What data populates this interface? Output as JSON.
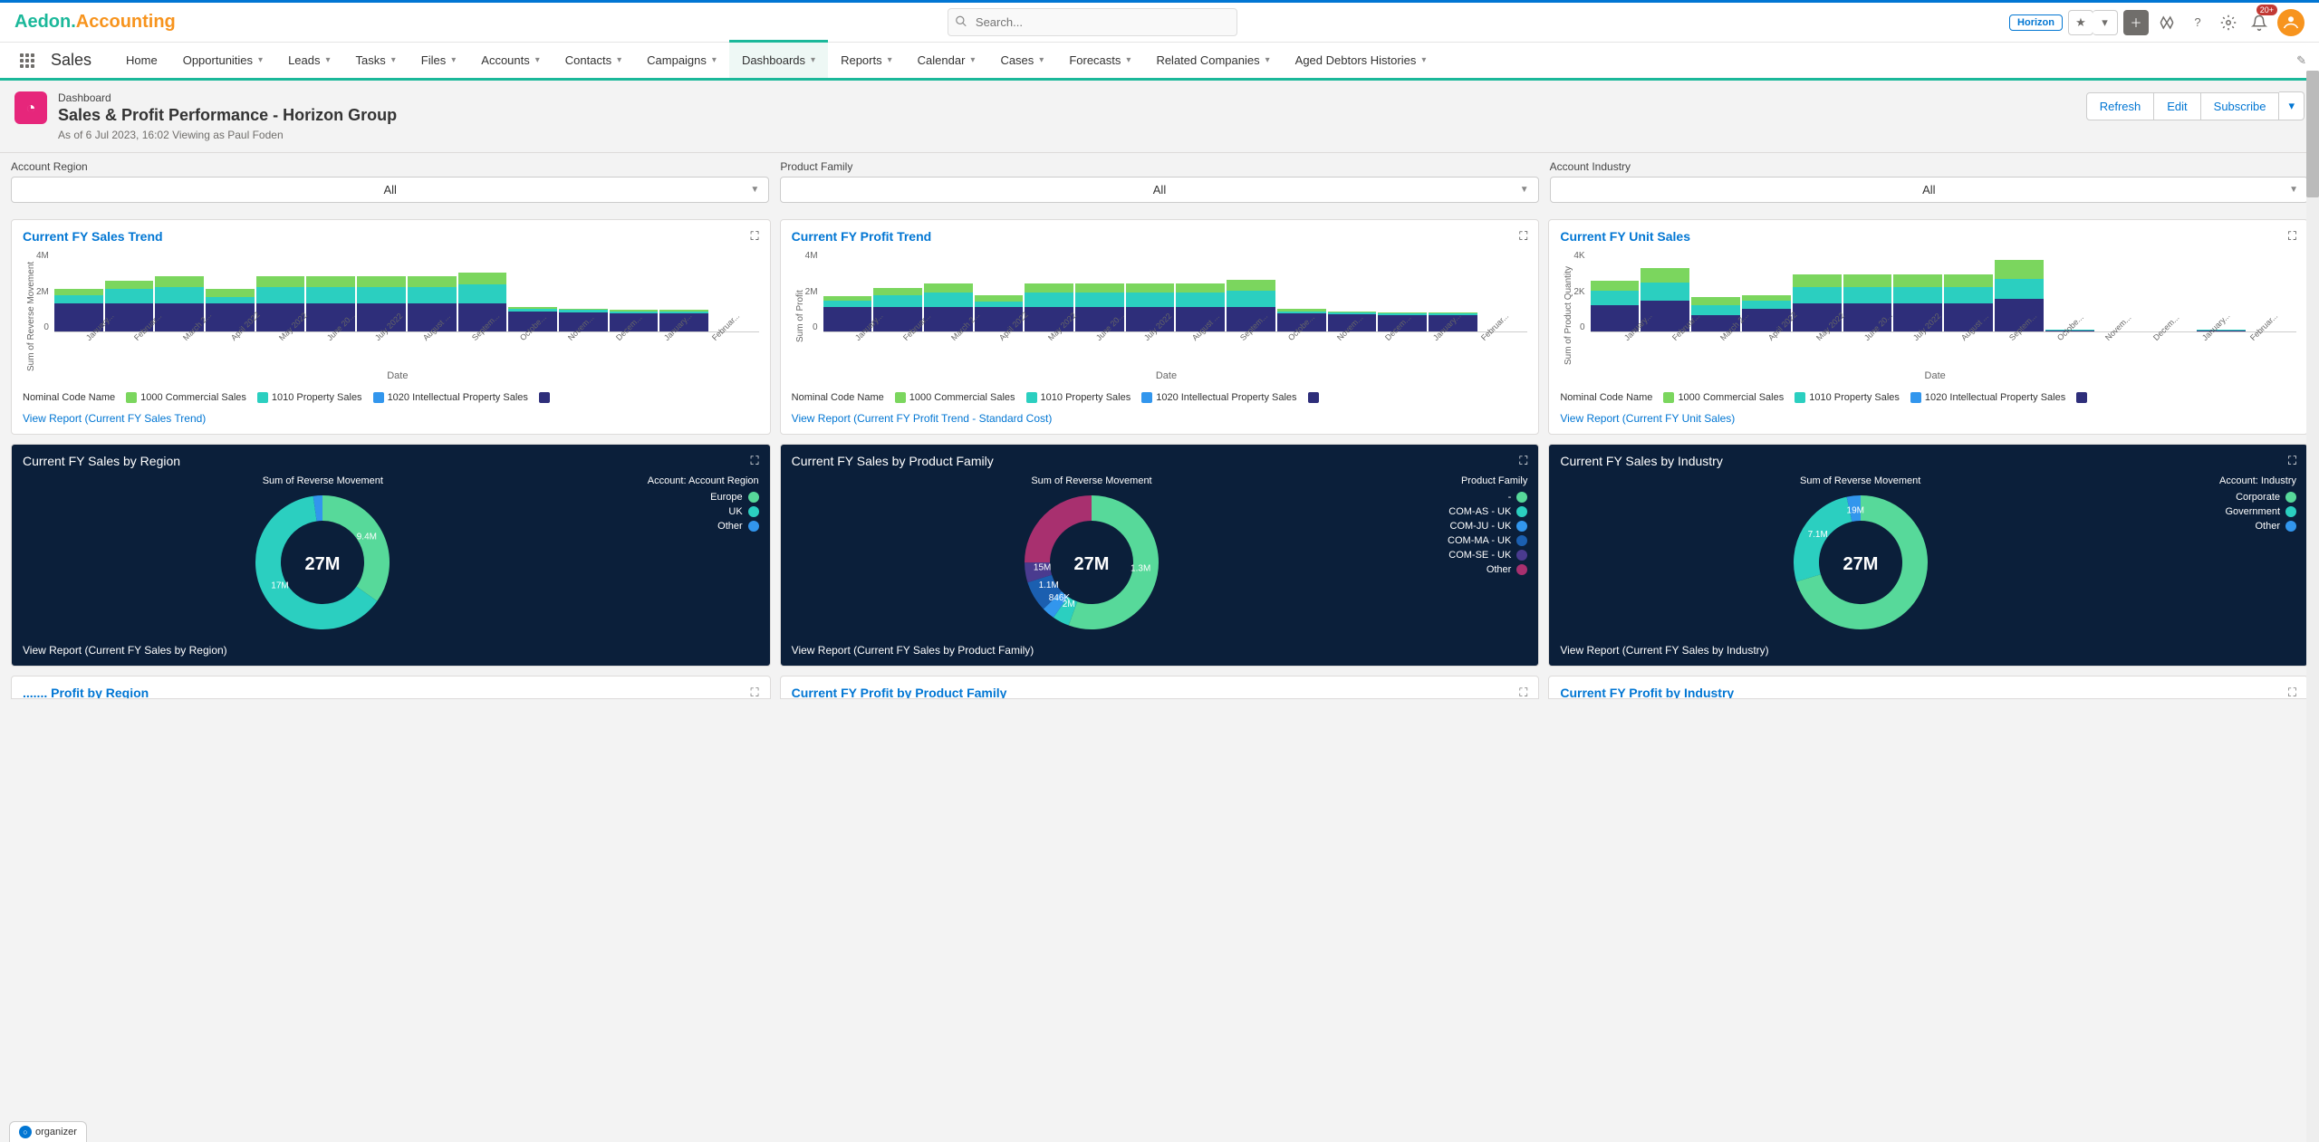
{
  "brand": {
    "a": "Aedon.",
    "b": "Accounting"
  },
  "search": {
    "placeholder": "Search..."
  },
  "header": {
    "horizon": "Horizon",
    "notif": "20+"
  },
  "nav": {
    "title": "Sales",
    "items": [
      "Home",
      "Opportunities",
      "Leads",
      "Tasks",
      "Files",
      "Accounts",
      "Contacts",
      "Campaigns",
      "Dashboards",
      "Reports",
      "Calendar",
      "Cases",
      "Forecasts",
      "Related Companies",
      "Aged Debtors Histories"
    ],
    "activeIndex": 8
  },
  "page": {
    "type": "Dashboard",
    "title": "Sales & Profit Performance - Horizon Group",
    "meta": "As of 6 Jul 2023, 16:02 Viewing as Paul Foden",
    "actions": {
      "refresh": "Refresh",
      "edit": "Edit",
      "subscribe": "Subscribe"
    }
  },
  "filters": [
    {
      "label": "Account Region",
      "value": "All"
    },
    {
      "label": "Product Family",
      "value": "All"
    },
    {
      "label": "Account Industry",
      "value": "All"
    }
  ],
  "legendLabel": "Nominal Code Name",
  "legendItems": [
    "1000 Commercial Sales",
    "1010 Property Sales",
    "1020 Intellectual Property Sales"
  ],
  "months": [
    "January...",
    "Februar...",
    "March 2...",
    "April 2022",
    "May 2022",
    "June 20...",
    "July 2022",
    "August ...",
    "Septem...",
    "Octobe...",
    "Novem...",
    "Decem...",
    "January...",
    "Februar..."
  ],
  "axisDate": "Date",
  "cards": {
    "sales": {
      "title": "Current FY Sales Trend",
      "ylabel": "Sum of Reverse Movement",
      "link": "View Report (Current FY Sales Trend)"
    },
    "profit": {
      "title": "Current FY Profit Trend",
      "ylabel": "Sum of Profit",
      "link": "View Report (Current FY Profit Trend - Standard Cost)"
    },
    "units": {
      "title": "Current FY Unit Sales",
      "ylabel": "Sum of Product Quantity",
      "link": "View Report (Current FY Unit Sales)"
    },
    "region": {
      "title": "Current FY Sales by Region",
      "link": "View Report (Current FY Sales by Region)",
      "legendTitle": "Account: Account Region",
      "center": "27M",
      "subtitle": "Sum of Reverse Movement"
    },
    "family": {
      "title": "Current FY Sales by Product Family",
      "link": "View Report (Current FY Sales by Product Family)",
      "legendTitle": "Product Family",
      "center": "27M",
      "subtitle": "Sum of Reverse Movement"
    },
    "industry": {
      "title": "Current FY Sales by Industry",
      "link": "View Report (Current FY Sales by Industry)",
      "legendTitle": "Account: Industry",
      "center": "27M",
      "subtitle": "Sum of Reverse Movement"
    }
  },
  "peek": {
    "region": "....... Profit by Region",
    "family": "Current FY Profit by Product Family",
    "industry": "Current FY Profit by Industry"
  },
  "donutLegends": {
    "region": [
      "Europe",
      "UK",
      "Other"
    ],
    "family": [
      "-",
      "COM-AS - UK",
      "COM-JU - UK",
      "COM-MA - UK",
      "COM-SE - UK",
      "Other"
    ],
    "industry": [
      "Corporate",
      "Government",
      "Other"
    ]
  },
  "donutLabels": {
    "region": [
      "9.4M",
      "17M"
    ],
    "family": [
      "1.3M",
      "2M",
      "846K",
      "1.1M",
      "15M"
    ],
    "industry": [
      "7.1M",
      "19M"
    ]
  },
  "organizer": "organizer",
  "chart_data": [
    {
      "id": "sales_trend",
      "type": "bar",
      "title": "Current FY Sales Trend",
      "xlabel": "Date",
      "ylabel": "Sum of Reverse Movement",
      "ylim": [
        0,
        4000000
      ],
      "yticks": [
        "4M",
        "2M",
        "0"
      ],
      "categories": [
        "Jan 2022",
        "Feb 2022",
        "Mar 2022",
        "Apr 2022",
        "May 2022",
        "Jun 2022",
        "Jul 2022",
        "Aug 2022",
        "Sep 2022",
        "Oct 2022",
        "Nov 2022",
        "Dec 2022",
        "Jan 2023",
        "Feb 2023"
      ],
      "series": [
        {
          "name": "1000 Commercial Sales",
          "values": [
            1400000,
            1400000,
            1400000,
            1400000,
            1400000,
            1400000,
            1400000,
            1400000,
            1400000,
            1000000,
            950000,
            900000,
            900000,
            0
          ]
        },
        {
          "name": "1010 Property Sales",
          "values": [
            400000,
            700000,
            800000,
            300000,
            800000,
            800000,
            800000,
            800000,
            900000,
            100000,
            100000,
            100000,
            100000,
            0
          ]
        },
        {
          "name": "1020 Intellectual Property Sales",
          "values": [
            300000,
            400000,
            500000,
            400000,
            500000,
            500000,
            500000,
            500000,
            600000,
            100000,
            50000,
            50000,
            50000,
            0
          ]
        }
      ]
    },
    {
      "id": "profit_trend",
      "type": "bar",
      "title": "Current FY Profit Trend",
      "xlabel": "Date",
      "ylabel": "Sum of Profit",
      "ylim": [
        0,
        4000000
      ],
      "yticks": [
        "4M",
        "2M",
        "0"
      ],
      "categories": [
        "Jan 2022",
        "Feb 2022",
        "Mar 2022",
        "Apr 2022",
        "May 2022",
        "Jun 2022",
        "Jul 2022",
        "Aug 2022",
        "Sep 2022",
        "Oct 2022",
        "Nov 2022",
        "Dec 2022",
        "Jan 2023",
        "Feb 2023"
      ],
      "series": [
        {
          "name": "1000 Commercial Sales",
          "values": [
            1200000,
            1200000,
            1200000,
            1200000,
            1200000,
            1200000,
            1200000,
            1200000,
            1200000,
            900000,
            850000,
            800000,
            800000,
            0
          ]
        },
        {
          "name": "1010 Property Sales",
          "values": [
            300000,
            600000,
            700000,
            250000,
            700000,
            700000,
            700000,
            700000,
            800000,
            100000,
            100000,
            100000,
            100000,
            0
          ]
        },
        {
          "name": "1020 Intellectual Property Sales",
          "values": [
            250000,
            350000,
            450000,
            350000,
            450000,
            450000,
            450000,
            450000,
            550000,
            100000,
            50000,
            50000,
            50000,
            0
          ]
        }
      ]
    },
    {
      "id": "unit_sales",
      "type": "bar",
      "title": "Current FY Unit Sales",
      "xlabel": "Date",
      "ylabel": "Sum of Product Quantity",
      "ylim": [
        0,
        4000
      ],
      "yticks": [
        "4K",
        "2K",
        "0"
      ],
      "categories": [
        "Jan 2022",
        "Feb 2022",
        "Mar 2022",
        "Apr 2022",
        "May 2022",
        "Jun 2022",
        "Jul 2022",
        "Aug 2022",
        "Sep 2022",
        "Oct 2022",
        "Nov 2022",
        "Dec 2022",
        "Jan 2023",
        "Feb 2023"
      ],
      "series": [
        {
          "name": "1000 Commercial Sales",
          "values": [
            1300,
            1500,
            800,
            1100,
            1400,
            1400,
            1400,
            1400,
            1600,
            50,
            0,
            0,
            50,
            0
          ]
        },
        {
          "name": "1010 Property Sales",
          "values": [
            700,
            900,
            500,
            400,
            800,
            800,
            800,
            800,
            1000,
            20,
            0,
            0,
            20,
            0
          ]
        },
        {
          "name": "1020 Intellectual Property Sales",
          "values": [
            500,
            700,
            400,
            300,
            600,
            600,
            600,
            600,
            900,
            10,
            0,
            0,
            10,
            0
          ]
        }
      ]
    },
    {
      "id": "sales_by_region",
      "type": "pie",
      "title": "Current FY Sales by Region",
      "total": "27M",
      "series": [
        {
          "name": "Europe",
          "value": 9400000
        },
        {
          "name": "UK",
          "value": 17000000
        },
        {
          "name": "Other",
          "value": 600000
        }
      ]
    },
    {
      "id": "sales_by_family",
      "type": "pie",
      "title": "Current FY Sales by Product Family",
      "total": "27M",
      "series": [
        {
          "name": "-",
          "value": 15000000
        },
        {
          "name": "COM-AS - UK",
          "value": 1100000
        },
        {
          "name": "COM-JU - UK",
          "value": 846000
        },
        {
          "name": "COM-MA - UK",
          "value": 2000000
        },
        {
          "name": "COM-SE - UK",
          "value": 1300000
        },
        {
          "name": "Other",
          "value": 6754000
        }
      ]
    },
    {
      "id": "sales_by_industry",
      "type": "pie",
      "title": "Current FY Sales by Industry",
      "total": "27M",
      "series": [
        {
          "name": "Corporate",
          "value": 19000000
        },
        {
          "name": "Government",
          "value": 7100000
        },
        {
          "name": "Other",
          "value": 900000
        }
      ]
    }
  ]
}
